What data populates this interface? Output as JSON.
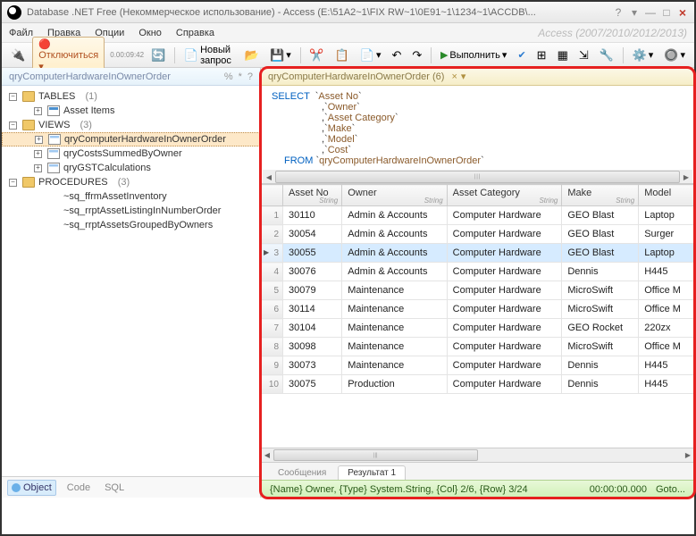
{
  "title": "Database .NET Free (Некоммерческое использование) - Access (E:\\51A2~1\\FIX RW~1\\0E91~1\\1234~1\\ACCDB\\...",
  "brand": "Access (2007/2010/2012/2013)",
  "menu": [
    "Файл",
    "Правка",
    "Опции",
    "Окно",
    "Справка"
  ],
  "toolbar": {
    "disconnect": "Отключиться",
    "timer": "0.00:09:42",
    "newquery": "Новый запрос",
    "execute": "Выполнить"
  },
  "side_tab": {
    "label": "qryComputerHardwareInOwnerOrder",
    "actions": [
      "%",
      "*",
      "?"
    ]
  },
  "tree": {
    "tables": {
      "label": "TABLES",
      "count": "(1)",
      "items": [
        "Asset Items"
      ]
    },
    "views": {
      "label": "VIEWS",
      "count": "(3)",
      "items": [
        "qryComputerHardwareInOwnerOrder",
        "qryCostsSummedByOwner",
        "qryGSTCalculations"
      ]
    },
    "procs": {
      "label": "PROCEDURES",
      "count": "(3)",
      "items": [
        "~sq_ffrmAssetInventory",
        "~sq_rrptAssetListingInNumberOrder",
        "~sq_rrptAssetsGroupedByOwners"
      ]
    }
  },
  "side_bottom": [
    "Object",
    "Code",
    "SQL"
  ],
  "query_tab": "qryComputerHardwareInOwnerOrder (6)",
  "sql": {
    "select": "SELECT",
    "fields": [
      "Asset No",
      "Owner",
      "Asset Category",
      "Make",
      "Model",
      "Cost"
    ],
    "from_kw": "FROM",
    "from_tbl": "qryComputerHardwareInOwnerOrder"
  },
  "grid": {
    "cols": [
      {
        "name": "Asset No",
        "type": "String"
      },
      {
        "name": "Owner",
        "type": "String"
      },
      {
        "name": "Asset Category",
        "type": "String"
      },
      {
        "name": "Make",
        "type": "String"
      },
      {
        "name": "Model",
        "type": ""
      }
    ],
    "rows": [
      {
        "n": "1",
        "c": [
          "30110",
          "Admin & Accounts",
          "Computer Hardware",
          "GEO Blast",
          "Laptop"
        ]
      },
      {
        "n": "2",
        "c": [
          "30054",
          "Admin & Accounts",
          "Computer Hardware",
          "GEO Blast",
          "Surger"
        ]
      },
      {
        "n": "3",
        "c": [
          "30055",
          "Admin & Accounts",
          "Computer Hardware",
          "GEO Blast",
          "Laptop"
        ],
        "sel": true
      },
      {
        "n": "4",
        "c": [
          "30076",
          "Admin & Accounts",
          "Computer Hardware",
          "Dennis",
          "H445"
        ]
      },
      {
        "n": "5",
        "c": [
          "30079",
          "Maintenance",
          "Computer Hardware",
          "MicroSwift",
          "Office M"
        ]
      },
      {
        "n": "6",
        "c": [
          "30114",
          "Maintenance",
          "Computer Hardware",
          "MicroSwift",
          "Office M"
        ]
      },
      {
        "n": "7",
        "c": [
          "30104",
          "Maintenance",
          "Computer Hardware",
          "GEO Rocket",
          "220zx"
        ]
      },
      {
        "n": "8",
        "c": [
          "30098",
          "Maintenance",
          "Computer Hardware",
          "MicroSwift",
          "Office M"
        ]
      },
      {
        "n": "9",
        "c": [
          "30073",
          "Maintenance",
          "Computer Hardware",
          "Dennis",
          "H445"
        ]
      },
      {
        "n": "10",
        "c": [
          "30075",
          "Production",
          "Computer Hardware",
          "Dennis",
          "H445"
        ]
      }
    ]
  },
  "result_tabs": [
    "Сообщения",
    "Результат 1"
  ],
  "status": {
    "left": "{Name} Owner, {Type} System.String, {Col} 2/6, {Row} 3/24",
    "time": "00:00:00.000",
    "goto": "Goto..."
  }
}
